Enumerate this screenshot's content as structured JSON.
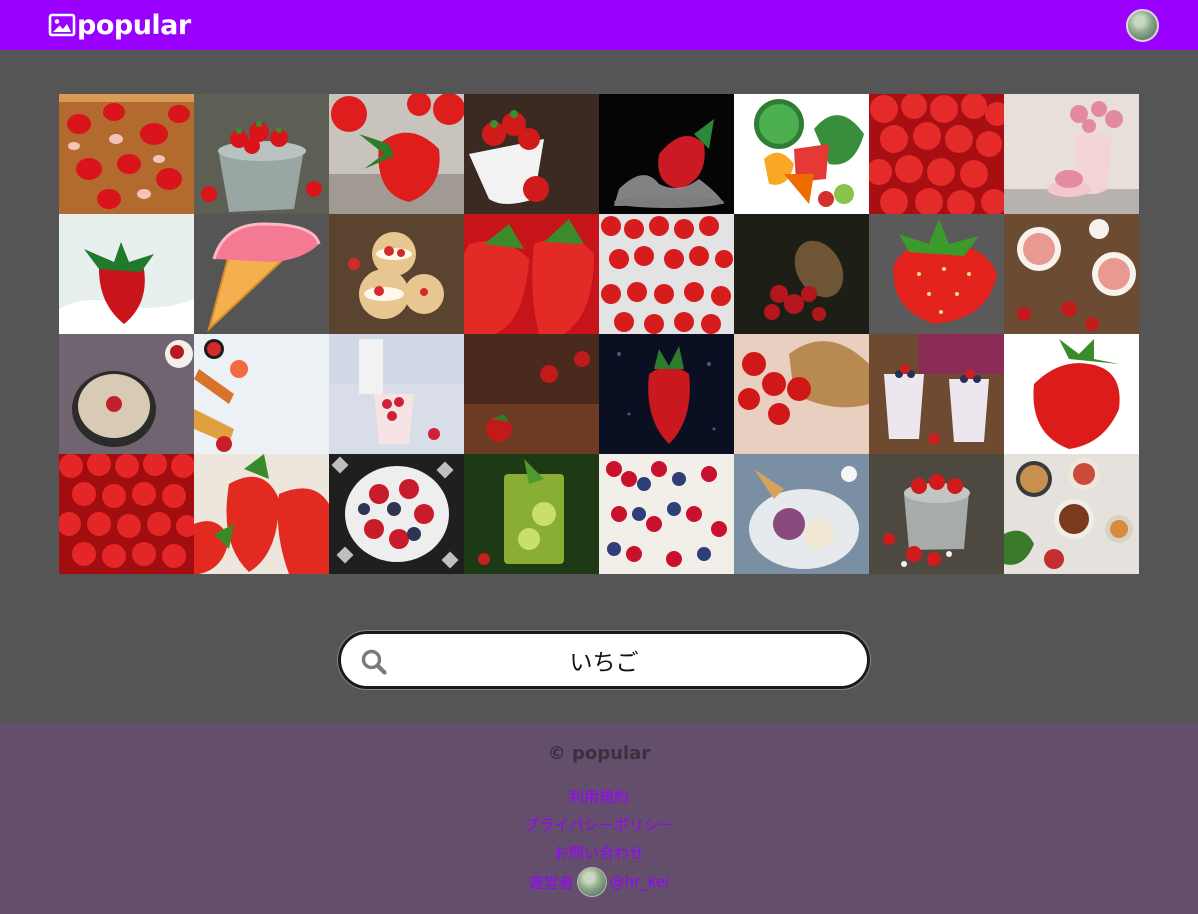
{
  "header": {
    "brand": "popular",
    "brand_icon": "image-icon",
    "accent": "#9900ff"
  },
  "grid": {
    "tiles": [
      {
        "name": "photo-sliced-strawberries-board",
        "icon": "photo"
      },
      {
        "name": "photo-strawberries-bucket",
        "icon": "photo"
      },
      {
        "name": "photo-strawberry-closeup-gravel",
        "icon": "photo"
      },
      {
        "name": "photo-strawberries-white-bowl",
        "icon": "photo"
      },
      {
        "name": "photo-strawberry-water-splash",
        "icon": "photo"
      },
      {
        "name": "illustration-fruits-vegetables",
        "icon": "photo"
      },
      {
        "name": "photo-strawberries-pile",
        "icon": "photo"
      },
      {
        "name": "photo-flowers-pitcher-table",
        "icon": "photo"
      },
      {
        "name": "photo-strawberry-milk-splash",
        "icon": "photo"
      },
      {
        "name": "illustration-ice-cream-cone",
        "icon": "photo"
      },
      {
        "name": "photo-cream-puffs-strawberries",
        "icon": "photo"
      },
      {
        "name": "photo-two-strawberries-closeup",
        "icon": "photo"
      },
      {
        "name": "photo-strawberry-baskets",
        "icon": "photo"
      },
      {
        "name": "photo-basket-dark-background",
        "icon": "photo"
      },
      {
        "name": "illustration-strawberry",
        "icon": "photo"
      },
      {
        "name": "photo-strawberry-ice-cream-cups",
        "icon": "photo"
      },
      {
        "name": "photo-oatmeal-bowl",
        "icon": "photo"
      },
      {
        "name": "photo-fruit-flatlay-white",
        "icon": "photo"
      },
      {
        "name": "photo-strawberry-parfait-milk",
        "icon": "photo"
      },
      {
        "name": "photo-strawberries-wood-table",
        "icon": "photo"
      },
      {
        "name": "photo-strawberry-bubbles-dark",
        "icon": "photo"
      },
      {
        "name": "photo-strawberries-wicker-basket",
        "icon": "photo"
      },
      {
        "name": "photo-berry-parfait-glasses",
        "icon": "photo"
      },
      {
        "name": "photo-single-strawberry-white",
        "icon": "photo"
      },
      {
        "name": "photo-strawberries-many",
        "icon": "photo"
      },
      {
        "name": "photo-strawberries-closeup-green",
        "icon": "photo"
      },
      {
        "name": "photo-berries-patterned-cloth",
        "icon": "photo"
      },
      {
        "name": "photo-lime-drink-glass",
        "icon": "photo"
      },
      {
        "name": "photo-berry-boxes",
        "icon": "photo"
      },
      {
        "name": "photo-ice-cream-plate",
        "icon": "photo"
      },
      {
        "name": "photo-strawberries-metal-bucket",
        "icon": "photo"
      },
      {
        "name": "photo-breakfast-bowls-table",
        "icon": "photo"
      }
    ]
  },
  "search": {
    "value": "いちご",
    "icon": "search-icon"
  },
  "footer": {
    "copyright": "© popular",
    "links": [
      "利用規約",
      "プライバシーポリシー",
      "お問い合わせ"
    ],
    "operator_label": "運営者",
    "operator_handle": "@hr_kei",
    "link_color": "#9a00ff",
    "background": "#634f6b"
  }
}
